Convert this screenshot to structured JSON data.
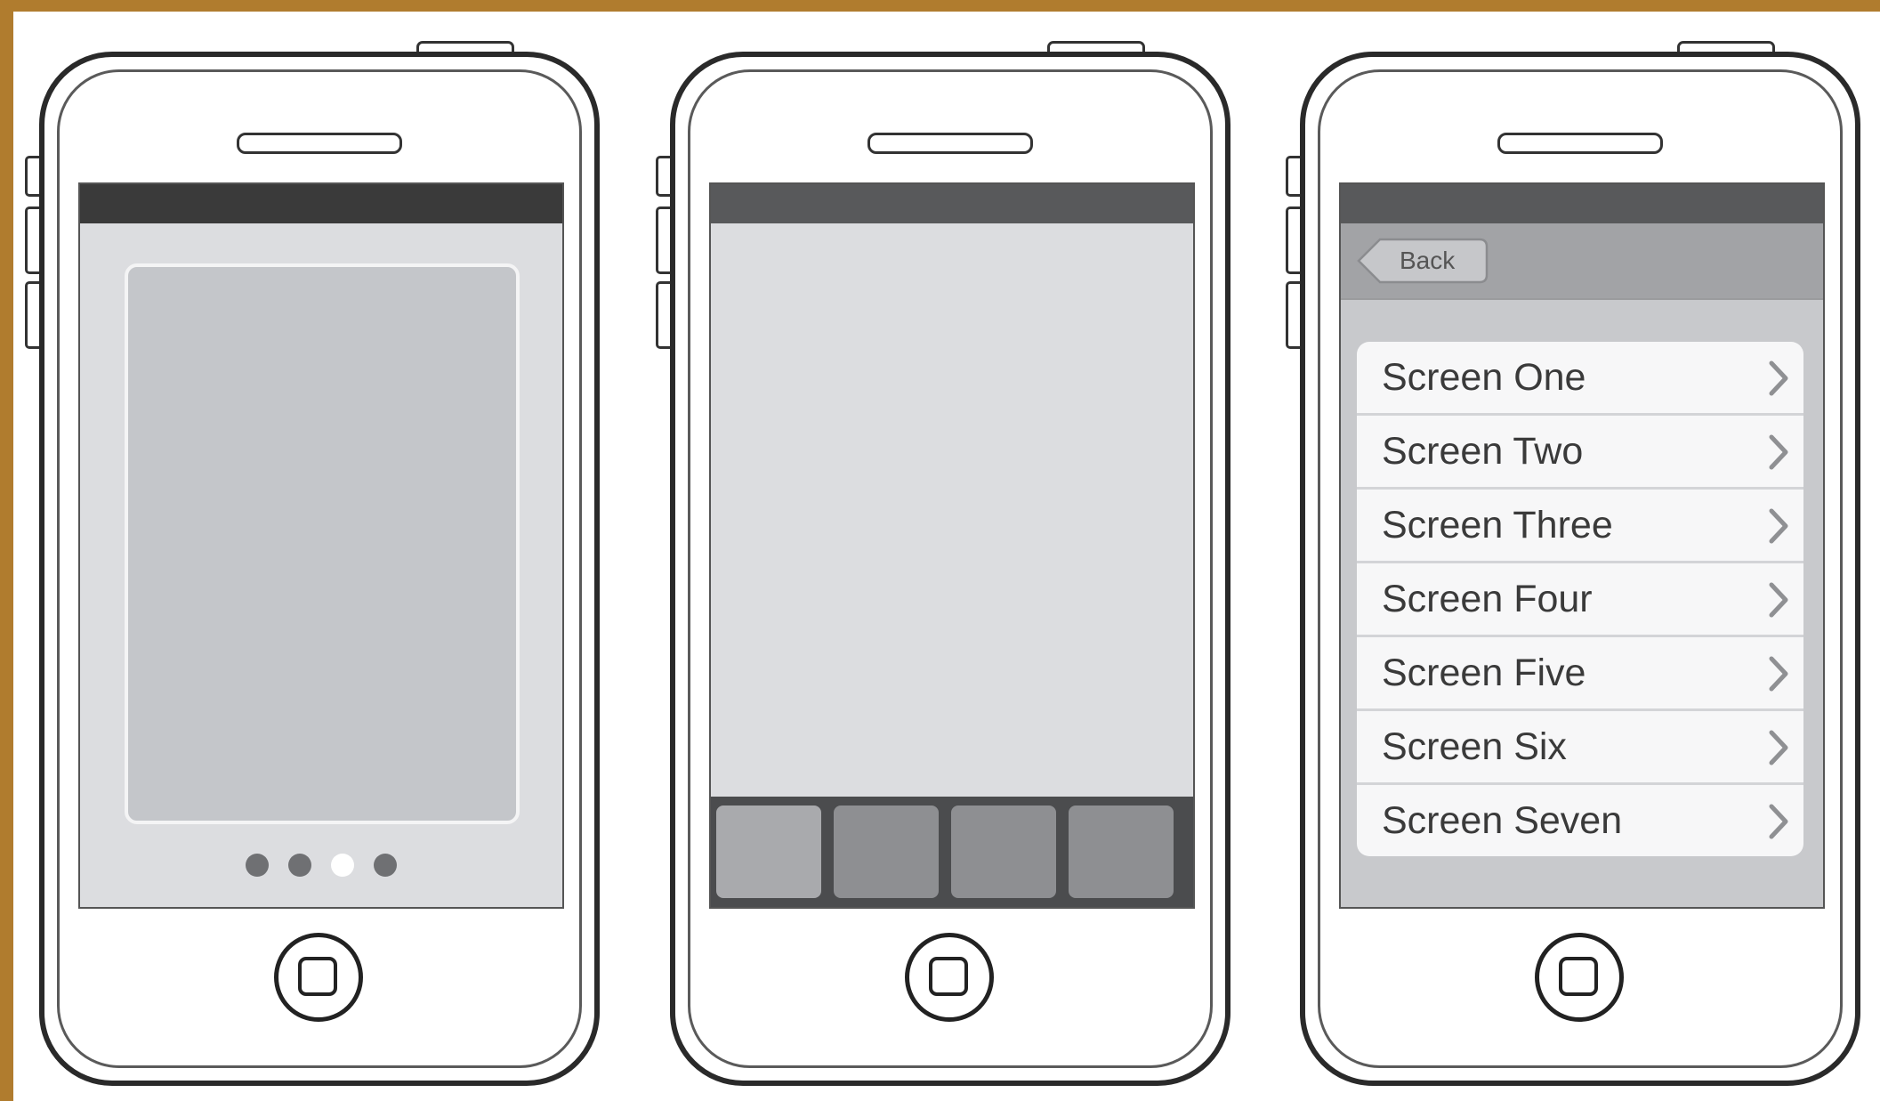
{
  "colors": {
    "frame_border": "#b07c2e",
    "screen_bg": "#dcdde0",
    "status_bar_dark": "#3a3a3a",
    "status_bar_mid": "#58595b",
    "page_card": "#c4c6ca",
    "dot_inactive": "#6f7073",
    "dot_active": "#ffffff",
    "tabbar": "#4b4c4e",
    "tab_first": "#a9aaad",
    "tab_other": "#8e8f92",
    "navbar": "#a2a3a6",
    "list_bg": "#c8c9cc",
    "row_bg": "#f7f7f8",
    "chevron": "#8f9093"
  },
  "phones": [
    {
      "id": "paged-screen",
      "page_dots": {
        "count": 4,
        "active_index": 2
      }
    },
    {
      "id": "tab-bar-screen",
      "tab_count": 4
    },
    {
      "id": "list-screen",
      "back_button": {
        "label": "Back"
      },
      "list_items": [
        {
          "label": "Screen One",
          "icon": "chevron-right-icon"
        },
        {
          "label": "Screen Two",
          "icon": "chevron-right-icon"
        },
        {
          "label": "Screen Three",
          "icon": "chevron-right-icon"
        },
        {
          "label": "Screen Four",
          "icon": "chevron-right-icon"
        },
        {
          "label": "Screen Five",
          "icon": "chevron-right-icon"
        },
        {
          "label": "Screen Six",
          "icon": "chevron-right-icon"
        },
        {
          "label": "Screen Seven",
          "icon": "chevron-right-icon"
        }
      ]
    }
  ]
}
